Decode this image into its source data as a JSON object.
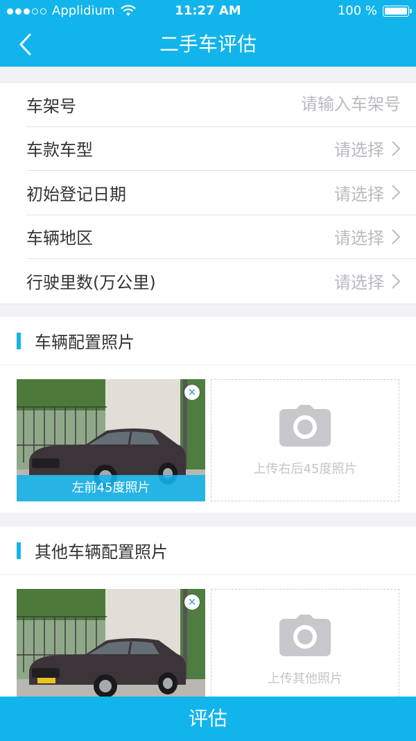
{
  "status_bar": {
    "carrier": "Applidium",
    "time": "11:27 AM",
    "battery": "100 %"
  },
  "nav": {
    "title": "二手车评估",
    "back_icon": "chevron-left-icon"
  },
  "form": {
    "vin": {
      "label": "车架号",
      "placeholder": "请输入车架号"
    },
    "rows": [
      {
        "label": "车款车型",
        "value": "请选择"
      },
      {
        "label": "初始登记日期",
        "value": "请选择"
      },
      {
        "label": "车辆地区",
        "value": "请选择"
      },
      {
        "label": "行驶里数(万公里)",
        "value": "请选择"
      }
    ]
  },
  "sections": [
    {
      "title": "车辆配置照片",
      "photo_caption": "左前45度照片",
      "upload_label": "上传右后45度照片"
    },
    {
      "title": "其他车辆配置照片",
      "photo_caption": "",
      "upload_label": "上传其他照片"
    }
  ],
  "colors": {
    "accent": "#12b4ec",
    "placeholder": "#b9b9c0",
    "car_body": "#3d343a"
  },
  "actions": {
    "evaluate_label": "评估"
  }
}
